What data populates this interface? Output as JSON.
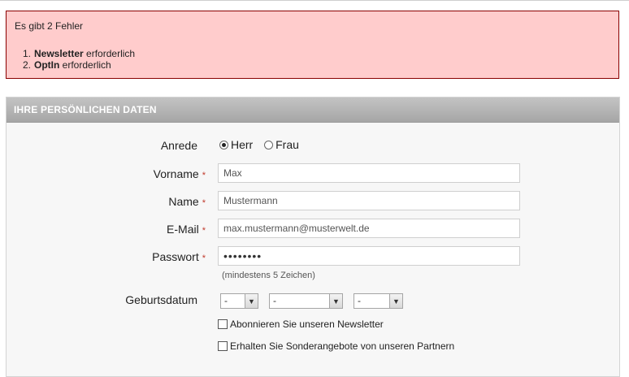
{
  "errors": {
    "title": "Es gibt 2 Fehler",
    "items": [
      {
        "num": "1.",
        "field": "Newsletter",
        "message": "erforderlich"
      },
      {
        "num": "2.",
        "field": "OptIn",
        "message": "erforderlich"
      }
    ]
  },
  "section": {
    "title": "IHRE PERSÖNLICHEN DATEN"
  },
  "form": {
    "salutation": {
      "label": "Anrede",
      "options": [
        {
          "label": "Herr",
          "checked": true
        },
        {
          "label": "Frau",
          "checked": false
        }
      ]
    },
    "required_marker": "*",
    "firstname": {
      "label": "Vorname",
      "value": "Max"
    },
    "lastname": {
      "label": "Name",
      "value": "Mustermann"
    },
    "email": {
      "label": "E-Mail",
      "value": "max.mustermann@musterwelt.de"
    },
    "password": {
      "label": "Passwort",
      "value": "••••••••",
      "hint": "(mindestens 5 Zeichen)"
    },
    "birthdate": {
      "label": "Geburtsdatum",
      "day": "-",
      "month": "-",
      "year": "-"
    },
    "newsletter": {
      "label": "Abonnieren Sie unseren Newsletter",
      "checked": false
    },
    "partner_offers": {
      "label": "Erhalten Sie Sonderangebote von unseren Partnern",
      "checked": false
    }
  }
}
